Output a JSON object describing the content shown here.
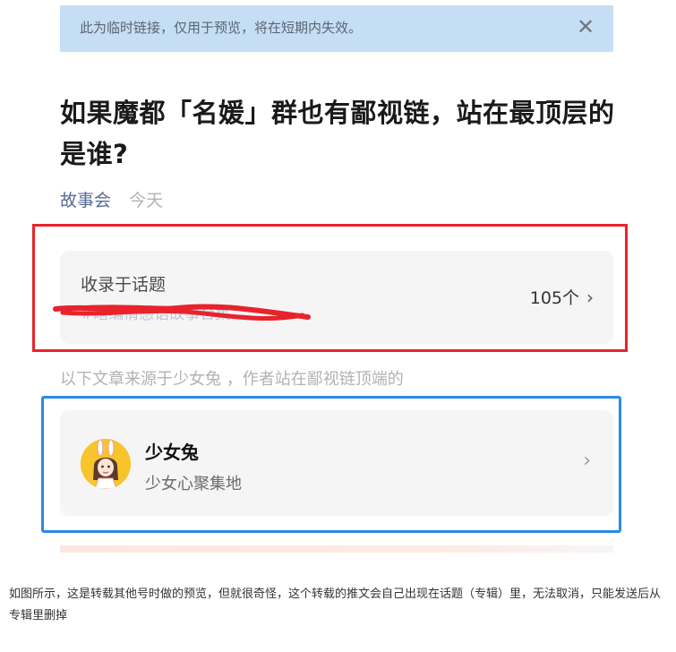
{
  "notice": {
    "text": "此为临时链接，仅用于预览，将在短期内失效。",
    "close_icon": "close-icon"
  },
  "article": {
    "title": "如果魔都「名媛」群也有鄙视链，站在最顶层的是谁?",
    "account": "故事会",
    "time": "今天"
  },
  "topic": {
    "label": "收录于话题",
    "name": "#瞎编情感语故事合集",
    "count": "105个",
    "chevron": "›"
  },
  "source_line": "以下文章来源于少女兔 ，作者站在鄙视链顶端的",
  "profile": {
    "name": "少女兔",
    "desc": "少女心聚集地",
    "chevron": "›",
    "avatar_icon": "bunny-girl-avatar-icon"
  },
  "caption": "如图所示，这是转载其他号时做的预览，但就很奇怪，这个转载的推文会自己出现在话题（专辑）里，无法取消，只能发送后从专辑里删掉",
  "colors": {
    "highlight_red": "#e8232c",
    "highlight_blue": "#2b8ae6",
    "notice_bg": "#c5def4",
    "link_blue": "#576b95"
  }
}
